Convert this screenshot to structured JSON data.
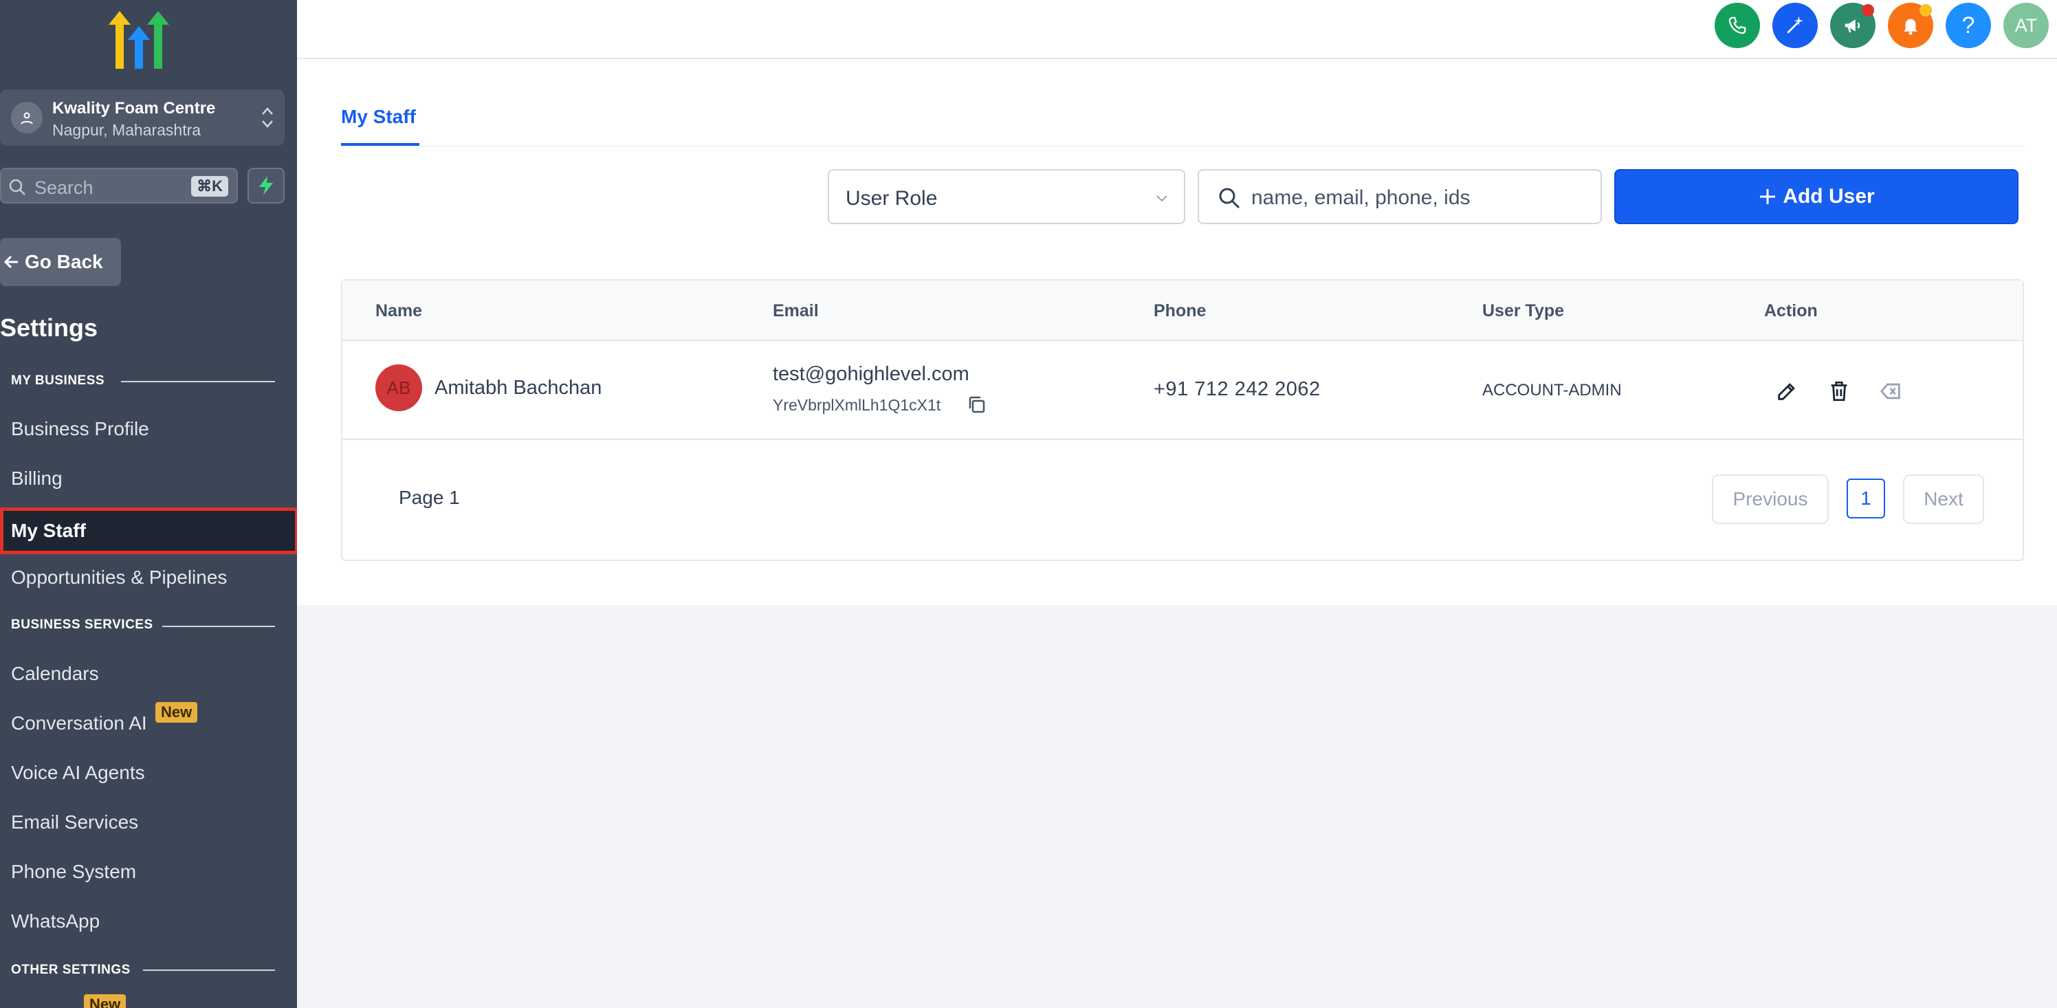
{
  "sidebar": {
    "location": {
      "name": "Kwality Foam Centre",
      "subtitle": "Nagpur, Maharashtra"
    },
    "search": {
      "placeholder": "Search",
      "shortcut": "⌘K"
    },
    "go_back": "Go Back",
    "title": "Settings",
    "sections": {
      "my_business": "MY BUSINESS",
      "business_services": "BUSINESS SERVICES",
      "other_settings": "OTHER SETTINGS"
    },
    "items": {
      "business_profile": "Business Profile",
      "billing": "Billing",
      "my_staff": "My Staff",
      "opportunities": "Opportunities & Pipelines",
      "calendars": "Calendars",
      "conversation_ai": "Conversation AI",
      "voice_ai": "Voice AI Agents",
      "email_services": "Email Services",
      "phone_system": "Phone System",
      "whatsapp": "WhatsApp"
    },
    "badges": {
      "new": "New",
      "new2": "New"
    }
  },
  "topbar": {
    "icons": [
      "phone-icon",
      "magic-wand-icon",
      "megaphone-icon",
      "bell-icon",
      "help-icon"
    ],
    "help_label": "?",
    "avatar_initials": "AT",
    "colors": {
      "phone": "#12a05c",
      "magic": "#155eef",
      "announce": "#2e8b6e",
      "bell": "#f97316",
      "help": "#1e90ff",
      "avatar": "#7fc49c"
    }
  },
  "main": {
    "tab": "My Staff",
    "filter": {
      "role_placeholder": "User Role",
      "search_placeholder": "name, email, phone, ids"
    },
    "add_user": "Add User",
    "table": {
      "headers": {
        "name": "Name",
        "email": "Email",
        "phone": "Phone",
        "user_type": "User Type",
        "action": "Action"
      },
      "rows": [
        {
          "initials": "AB",
          "name": "Amitabh Bachchan",
          "email": "test@gohighlevel.com",
          "id": "YreVbrplXmlLh1Q1cX1t",
          "phone": "+91 712 242 2062",
          "user_type": "ACCOUNT-ADMIN"
        }
      ]
    },
    "pagination": {
      "page_label": "Page 1",
      "previous": "Previous",
      "current": "1",
      "next": "Next"
    }
  }
}
